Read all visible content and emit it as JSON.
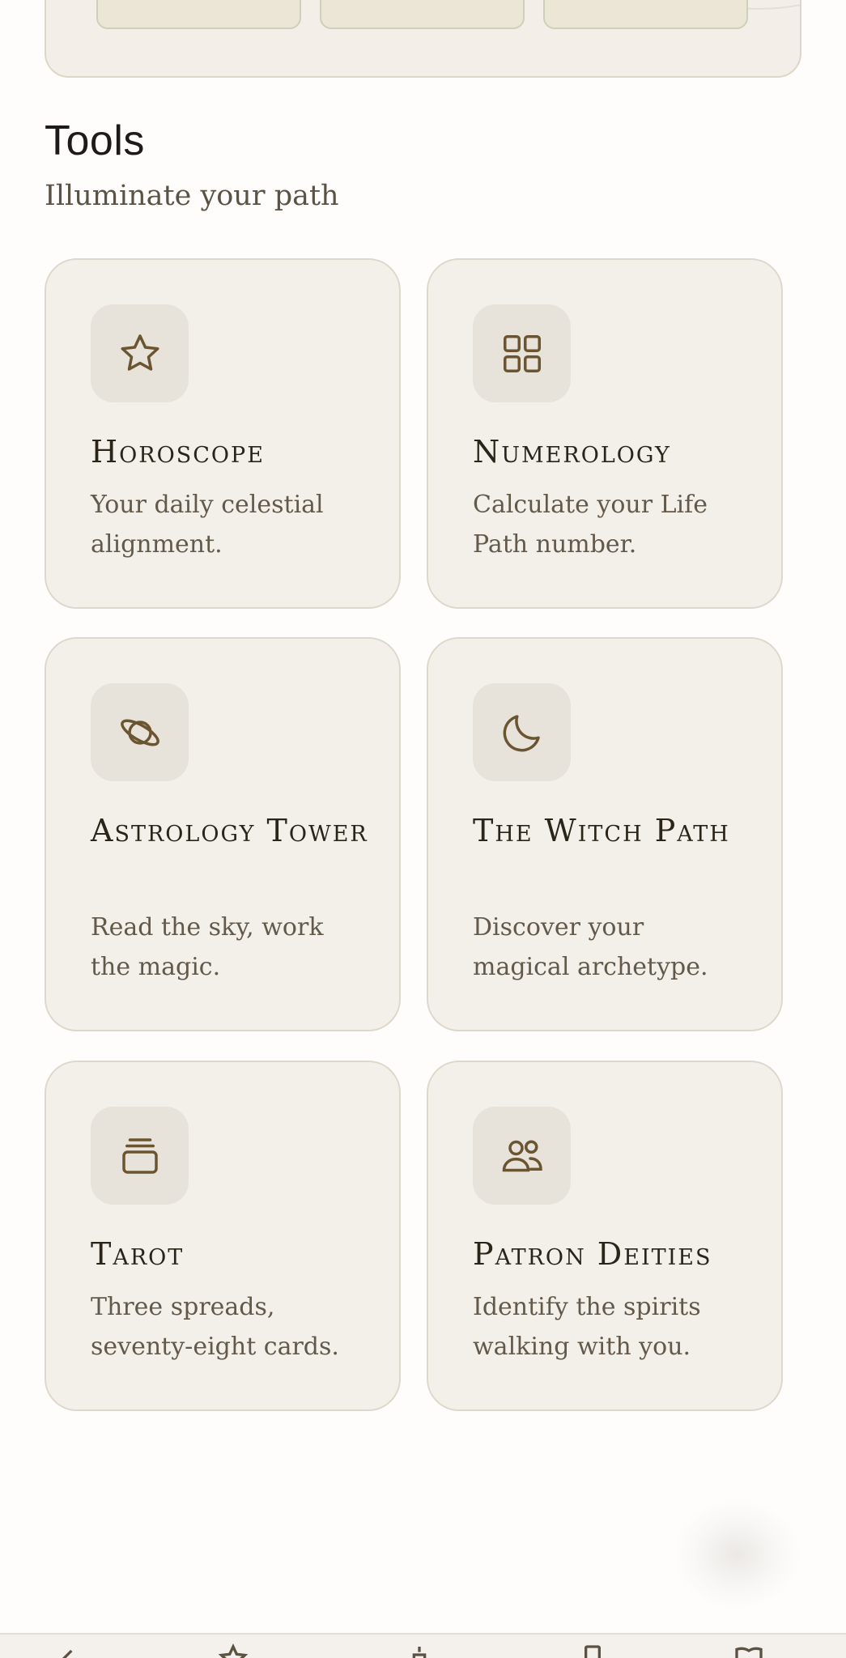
{
  "section": {
    "title": "Tools",
    "subtitle": "Illuminate your path"
  },
  "tools": [
    {
      "title": "Horoscope",
      "description": "Your daily celestial alignment.",
      "icon": "star-icon"
    },
    {
      "title": "Numerology",
      "description": "Calculate your Life Path number.",
      "icon": "grid-icon"
    },
    {
      "title": "Astrology Tower",
      "description": "Read the sky, work the magic.",
      "icon": "planet-icon"
    },
    {
      "title": "The Witch Path",
      "description": "Discover your magical archetype.",
      "icon": "moon-icon"
    },
    {
      "title": "Tarot",
      "description": "Three spreads, seventy-eight cards.",
      "icon": "card-stack-icon"
    },
    {
      "title": "Patron Deities",
      "description": "Identify the spirits walking with you.",
      "icon": "users-icon"
    }
  ],
  "colors": {
    "background": "#fefdfc",
    "card": "#f3f0ea",
    "icon_tile": "#e7e2da",
    "icon_stroke": "#6b5530",
    "title_text": "#2a2419",
    "desc_text": "#62594b"
  }
}
